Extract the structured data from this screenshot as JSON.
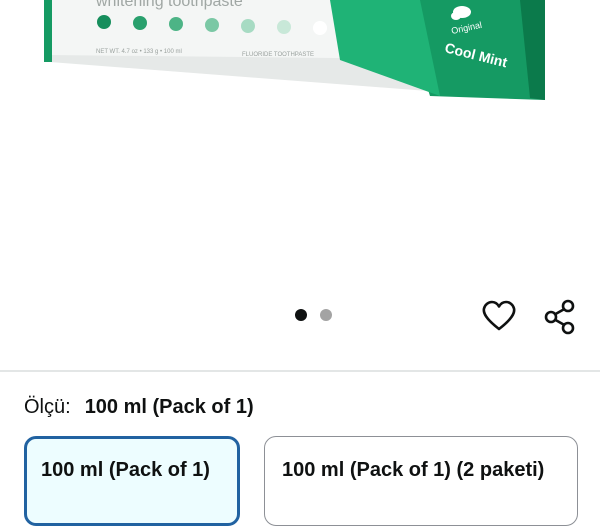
{
  "product": {
    "image_alt": "Whitening toothpaste tube, Original Cool Mint",
    "tube_brand_text": "whitening toothpaste",
    "tube_net_weight": "NET WT. 4.7 oz • 133 g • 100 ml",
    "tube_type": "FLUORIDE TOOTHPASTE",
    "tube_flavor_original": "Original",
    "tube_flavor_name": "Cool Mint",
    "colors": {
      "tube_green": "#159a63",
      "tube_green_dark": "#0b7a4b",
      "tube_band": "#f4f6f5"
    }
  },
  "carousel": {
    "total": 2,
    "active_index": 0
  },
  "actions": {
    "favorite_icon": "heart-outline-icon",
    "share_icon": "share-icon"
  },
  "size_selector": {
    "label": "Ölçü:",
    "selected_value": "100 ml (Pack of 1)",
    "options": [
      {
        "label": "100 ml (Pack of 1)",
        "selected": true
      },
      {
        "label": "100 ml (Pack of 1) (2 paketi)",
        "selected": false
      }
    ],
    "colors": {
      "selected_border": "#2162a1",
      "selected_bg": "#edfdff",
      "unselected_border": "#8d9096"
    }
  }
}
